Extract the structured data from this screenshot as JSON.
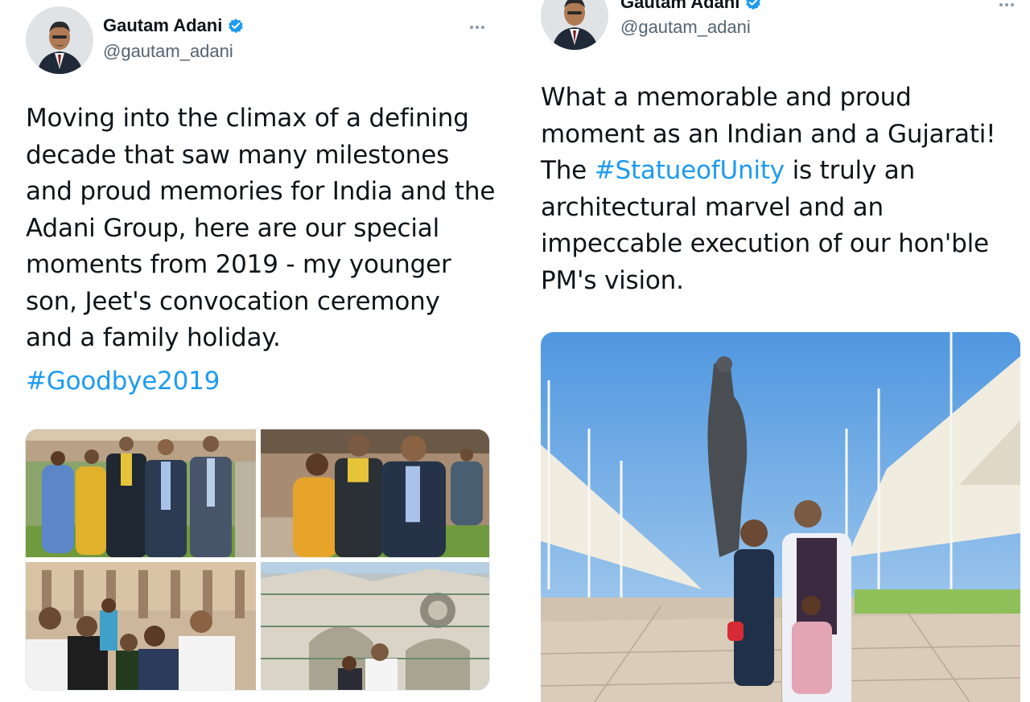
{
  "left_tweet": {
    "display_name": "Gautam Adani",
    "handle": "@gautam_adani",
    "text_lines": [
      "Moving into the climax of a defining",
      "decade that saw many milestones",
      "and proud memories for India and the",
      "Adani Group, here are our special",
      "moments from 2019 - my younger",
      "son, Jeet's convocation ceremony",
      "and a family holiday."
    ],
    "hashtag": "#Goodbye2019",
    "media": {
      "photos": [
        "convocation-group-photo",
        "convocation-trio-photo",
        "florence-family-photo",
        "florence-cathedral-photo"
      ]
    }
  },
  "right_tweet": {
    "display_name": "Gautam Adani",
    "handle": "@gautam_adani",
    "text_line_1": "What a memorable and proud",
    "text_line_2": "moment as an Indian and a Gujarati!",
    "text_line_3_prefix": "The ",
    "text_line_3_hashtag": "#StatueofUnity",
    "text_line_3_suffix": " is truly an",
    "text_line_4": "architectural marvel and an",
    "text_line_5": "impeccable execution of our hon'ble",
    "text_line_6": "PM's vision.",
    "media": {
      "photo": "statue-of-unity-family-photo"
    }
  },
  "colors": {
    "hashtag": "#1d9bf0",
    "verified": "#1d9bf0",
    "text": "#0f1419",
    "secondary": "#536471"
  },
  "icons": [
    "verified-badge-icon",
    "more-options-icon"
  ]
}
